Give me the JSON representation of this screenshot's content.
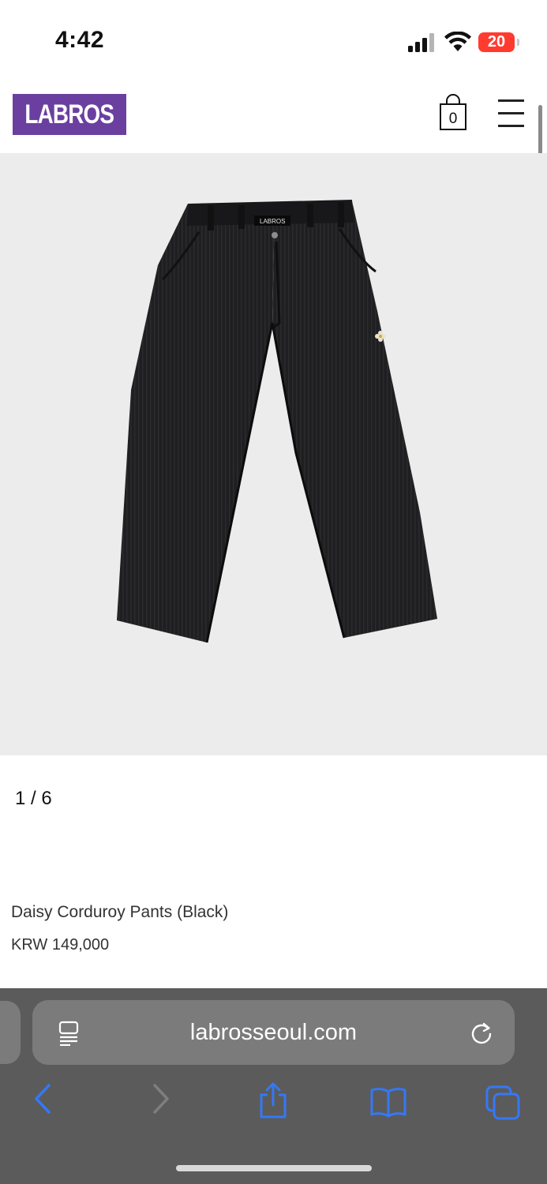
{
  "status_bar": {
    "time": "4:42",
    "battery_level": "20",
    "battery_color": "#ff3b30"
  },
  "header": {
    "logo_text": "LABROS",
    "logo_color": "#6b3fa0",
    "cart_count": "0",
    "cart_icon": "shopping-bag-icon",
    "menu_icon": "hamburger-menu-icon"
  },
  "product": {
    "image_alt": "Daisy Corduroy Pants (Black)",
    "slide_counter": "1 / 6",
    "name": "Daisy Corduroy Pants (Black)",
    "price": "KRW 149,000",
    "waistband_label": "LABROS"
  },
  "browser": {
    "url": "labrosseoul.com",
    "icons": {
      "reader": "reader-view-icon",
      "reload": "reload-icon",
      "back": "back-arrow-icon",
      "forward": "forward-arrow-icon",
      "share": "share-icon",
      "bookmarks": "bookmarks-icon",
      "tabs": "tabs-icon"
    },
    "accent_color": "#3478f6"
  }
}
